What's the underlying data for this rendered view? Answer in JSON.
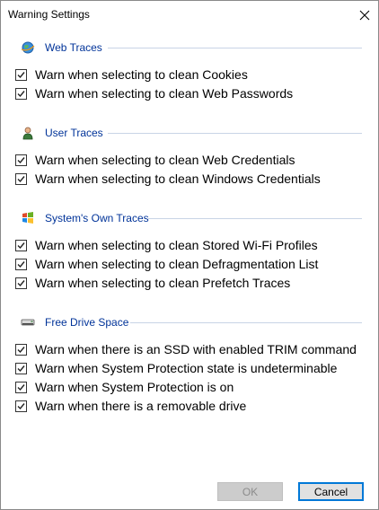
{
  "window": {
    "title": "Warning Settings",
    "close_icon": "close-icon"
  },
  "sections": [
    {
      "title": "Web Traces",
      "icon": "globe-icon",
      "items": [
        {
          "label": "Warn when selecting to clean Cookies",
          "checked": true
        },
        {
          "label": "Warn when selecting to clean Web Passwords",
          "checked": true
        }
      ]
    },
    {
      "title": "User Traces",
      "icon": "user-icon",
      "items": [
        {
          "label": "Warn when selecting to clean Web Credentials",
          "checked": true
        },
        {
          "label": "Warn when selecting to clean Windows Credentials",
          "checked": true
        }
      ]
    },
    {
      "title": "System's Own Traces",
      "icon": "windows-icon",
      "items": [
        {
          "label": "Warn when selecting to clean Stored Wi-Fi Profiles",
          "checked": true
        },
        {
          "label": "Warn when selecting to clean Defragmentation List",
          "checked": true
        },
        {
          "label": "Warn when selecting to clean Prefetch Traces",
          "checked": true
        }
      ]
    },
    {
      "title": "Free Drive Space",
      "icon": "drive-icon",
      "items": [
        {
          "label": "Warn when there is an SSD with enabled TRIM command",
          "checked": true
        },
        {
          "label": "Warn when System Protection state is undeterminable",
          "checked": true
        },
        {
          "label": "Warn when System Protection is on",
          "checked": true
        },
        {
          "label": "Warn when there is a removable drive",
          "checked": true
        }
      ]
    }
  ],
  "buttons": {
    "ok_label": "OK",
    "ok_enabled": false,
    "cancel_label": "Cancel"
  },
  "colors": {
    "section_title": "#003399",
    "accent": "#0078d7"
  }
}
